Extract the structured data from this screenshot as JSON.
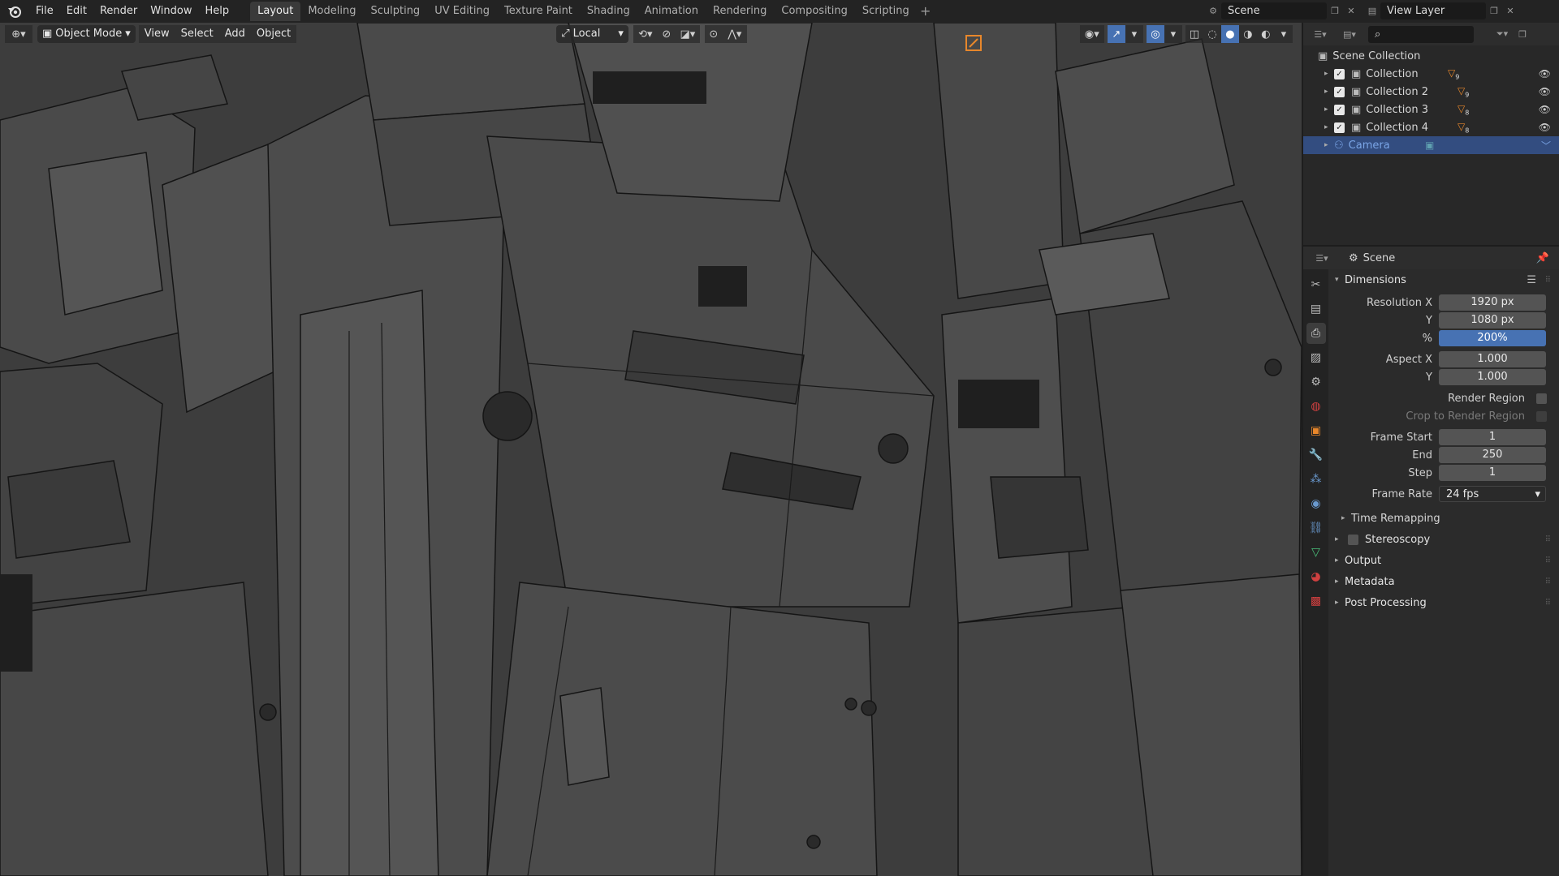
{
  "menu": [
    "File",
    "Edit",
    "Render",
    "Window",
    "Help"
  ],
  "workspaces": [
    "Layout",
    "Modeling",
    "Sculpting",
    "UV Editing",
    "Texture Paint",
    "Shading",
    "Animation",
    "Rendering",
    "Compositing",
    "Scripting"
  ],
  "active_workspace": "Layout",
  "scene_name": "Scene",
  "view_layer": "View Layer",
  "viewport_header": {
    "mode": "Object Mode",
    "view": "View",
    "select": "Select",
    "add": "Add",
    "object": "Object",
    "transform_orientation": "Local"
  },
  "outliner": {
    "root": "Scene Collection",
    "items": [
      {
        "name": "Collection",
        "badge": "9"
      },
      {
        "name": "Collection 2",
        "badge": "9"
      },
      {
        "name": "Collection 3",
        "badge": "8"
      },
      {
        "name": "Collection 4",
        "badge": "8"
      },
      {
        "name": "Camera",
        "badge": ""
      }
    ]
  },
  "properties": {
    "context": "Scene",
    "panel": "Dimensions",
    "resolution_x_label": "Resolution X",
    "resolution_x": "1920 px",
    "resolution_y_label": "Y",
    "resolution_y": "1080 px",
    "percent_label": "%",
    "percent": "200%",
    "aspect_x_label": "Aspect X",
    "aspect_x": "1.000",
    "aspect_y_label": "Y",
    "aspect_y": "1.000",
    "render_region": "Render Region",
    "crop_region": "Crop to Render Region",
    "frame_start_label": "Frame Start",
    "frame_start": "1",
    "frame_end_label": "End",
    "frame_end": "250",
    "frame_step_label": "Step",
    "frame_step": "1",
    "frame_rate_label": "Frame Rate",
    "frame_rate": "24 fps",
    "time_remapping": "Time Remapping",
    "stereoscopy": "Stereoscopy",
    "output": "Output",
    "metadata": "Metadata",
    "post_processing": "Post Processing"
  },
  "colors": {
    "accent": "#4772b3",
    "selection": "#334d80",
    "orange_icon": "#e8872b"
  }
}
